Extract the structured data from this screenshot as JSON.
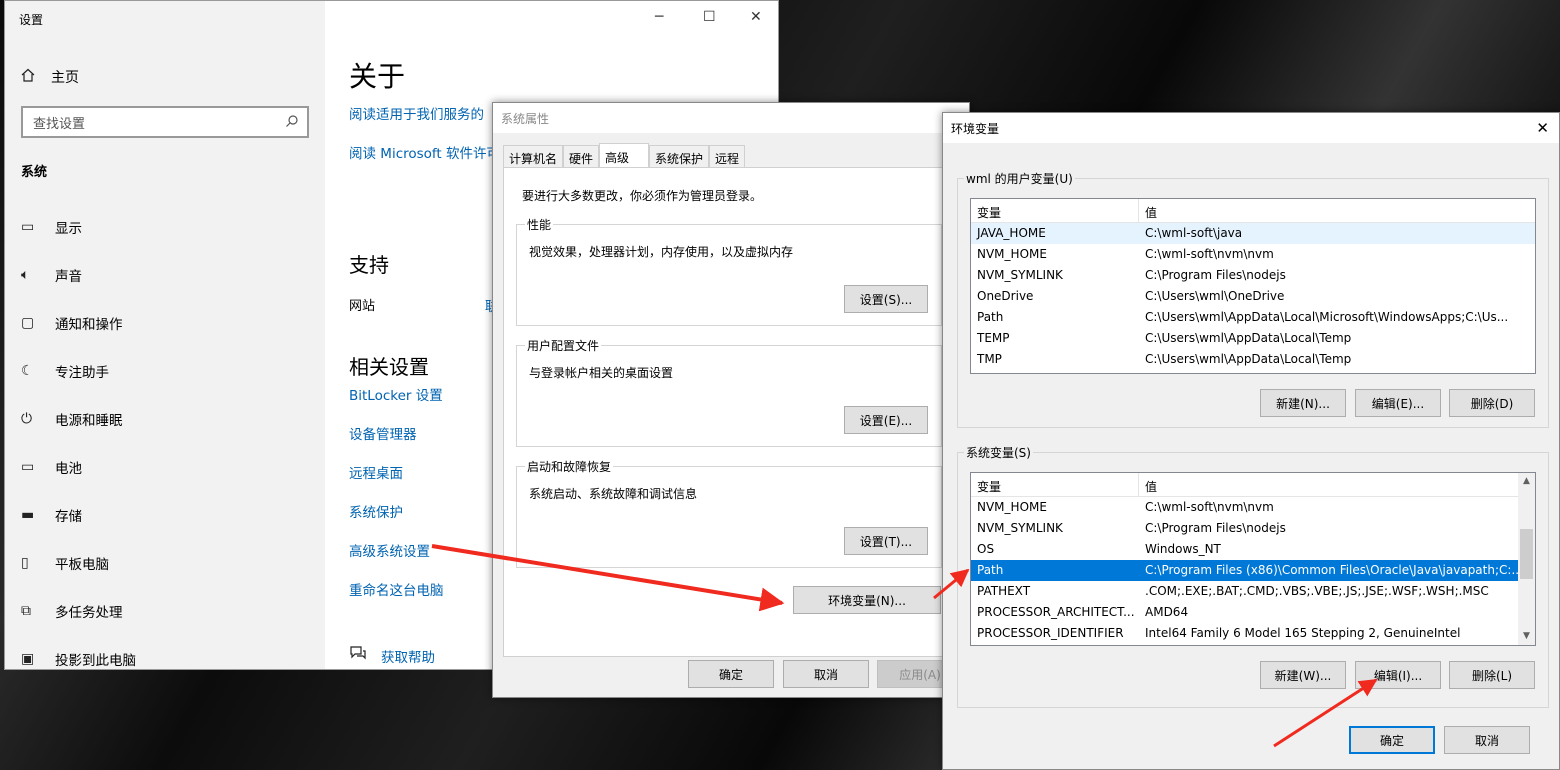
{
  "settings": {
    "title": "设置",
    "home": "主页",
    "search_placeholder": "查找设置",
    "section": "系统",
    "nav": [
      "显示",
      "声音",
      "通知和操作",
      "专注助手",
      "电源和睡眠",
      "电池",
      "存储",
      "平板电脑",
      "多任务处理",
      "投影到此电脑"
    ],
    "about_title": "关于",
    "link_services": "阅读适用于我们服务的",
    "link_license": "阅读 Microsoft 软件许可",
    "support_title": "支持",
    "website": "网站",
    "website_link": "联",
    "related_title": "相关设置",
    "related_links": [
      "BitLocker 设置",
      "设备管理器",
      "远程桌面",
      "系统保护",
      "高级系统设置",
      "重命名这台电脑"
    ],
    "help": "获取帮助"
  },
  "sysprop": {
    "title": "系统属性",
    "tabs": [
      "计算机名",
      "硬件",
      "高级",
      "系统保护",
      "远程"
    ],
    "note": "要进行大多数更改，你必须作为管理员登录。",
    "groups": [
      {
        "label": "性能",
        "desc": "视觉效果，处理器计划，内存使用，以及虚拟内存",
        "button": "设置(S)..."
      },
      {
        "label": "用户配置文件",
        "desc": "与登录帐户相关的桌面设置",
        "button": "设置(E)..."
      },
      {
        "label": "启动和故障恢复",
        "desc": "系统启动、系统故障和调试信息",
        "button": "设置(T)..."
      }
    ],
    "env_button": "环境变量(N)...",
    "ok": "确定",
    "cancel": "取消",
    "apply": "应用(A)"
  },
  "envvars": {
    "title": "环境变量",
    "user_label": "wml 的用户变量(U)",
    "col_var": "变量",
    "col_val": "值",
    "user_rows": [
      {
        "name": "JAVA_HOME",
        "value": "C:\\wml-soft\\java"
      },
      {
        "name": "NVM_HOME",
        "value": "C:\\wml-soft\\nvm\\nvm"
      },
      {
        "name": "NVM_SYMLINK",
        "value": "C:\\Program Files\\nodejs"
      },
      {
        "name": "OneDrive",
        "value": "C:\\Users\\wml\\OneDrive"
      },
      {
        "name": "Path",
        "value": "C:\\Users\\wml\\AppData\\Local\\Microsoft\\WindowsApps;C:\\Us..."
      },
      {
        "name": "TEMP",
        "value": "C:\\Users\\wml\\AppData\\Local\\Temp"
      },
      {
        "name": "TMP",
        "value": "C:\\Users\\wml\\AppData\\Local\\Temp"
      }
    ],
    "user_buttons": [
      "新建(N)...",
      "编辑(E)...",
      "删除(D)"
    ],
    "sys_label": "系统变量(S)",
    "sys_rows": [
      {
        "name": "NVM_HOME",
        "value": "C:\\wml-soft\\nvm\\nvm"
      },
      {
        "name": "NVM_SYMLINK",
        "value": "C:\\Program Files\\nodejs"
      },
      {
        "name": "OS",
        "value": "Windows_NT"
      },
      {
        "name": "Path",
        "value": "C:\\Program Files (x86)\\Common Files\\Oracle\\Java\\javapath;C:..."
      },
      {
        "name": "PATHEXT",
        "value": ".COM;.EXE;.BAT;.CMD;.VBS;.VBE;.JS;.JSE;.WSF;.WSH;.MSC"
      },
      {
        "name": "PROCESSOR_ARCHITECT...",
        "value": "AMD64"
      },
      {
        "name": "PROCESSOR_IDENTIFIER",
        "value": "Intel64 Family 6 Model 165 Stepping 2, GenuineIntel"
      }
    ],
    "sys_buttons": [
      "新建(W)...",
      "编辑(I)...",
      "删除(L)"
    ],
    "ok": "确定",
    "cancel": "取消"
  },
  "colors": {
    "link": "#0063b1",
    "selection": "#0078d7",
    "annotation_arrow": "#f02a1e"
  }
}
